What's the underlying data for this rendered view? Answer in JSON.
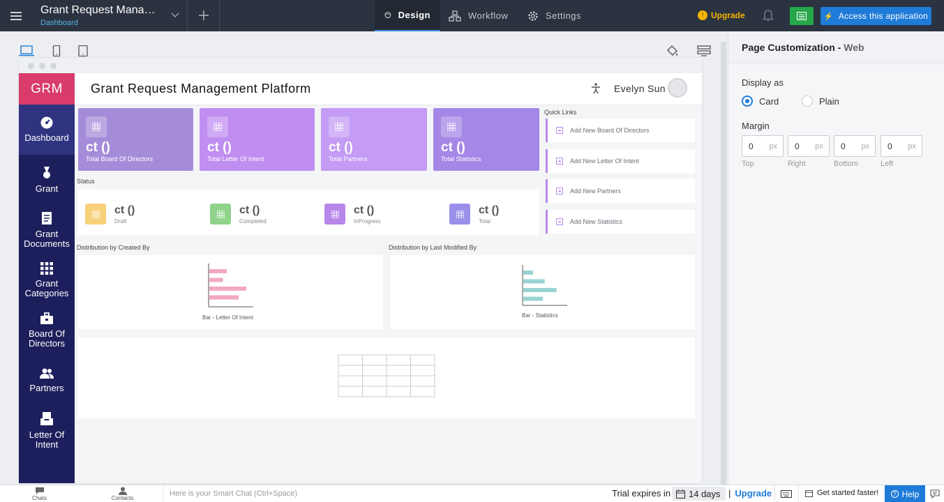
{
  "topbar": {
    "app_title": "Grant Request Manageme...",
    "app_subtitle": "Dashboard",
    "tabs": [
      {
        "label": "Design"
      },
      {
        "label": "Workflow"
      },
      {
        "label": "Settings"
      }
    ],
    "upgrade_label": "Upgrade",
    "access_label": "Access this application"
  },
  "preview": {
    "logo": "GRM",
    "sidebar": [
      {
        "label": "Dashboard"
      },
      {
        "label": "Grant"
      },
      {
        "label": "Grant Documents"
      },
      {
        "label": "Grant Categories"
      },
      {
        "label": "Board Of Directors"
      },
      {
        "label": "Partners"
      },
      {
        "label": "Letter Of Intent"
      }
    ],
    "header_title": "Grant Request Management Platform",
    "user_name": "Evelyn Sun",
    "stat_cards": [
      {
        "value": "ct ()",
        "label": "Total Board Of Directors",
        "color": "#a58cd9"
      },
      {
        "value": "ct ()",
        "label": "Total Letter Of Intent",
        "color": "#c08ef0"
      },
      {
        "value": "ct ()",
        "label": "Total Partners",
        "color": "#c49bf5"
      },
      {
        "value": "ct ()",
        "label": "Total Statistics",
        "color": "#a487e6"
      }
    ],
    "quick_links_title": "Quick Links",
    "quick_links": [
      {
        "label": "Add New Board Of Directors"
      },
      {
        "label": "Add New Letter Of Intent"
      },
      {
        "label": "Add New Partners"
      },
      {
        "label": "Add New Statistics"
      }
    ],
    "status_title": "Status",
    "status_items": [
      {
        "value": "ct ()",
        "label": "Draft",
        "color": "#f7d07a"
      },
      {
        "value": "ct ()",
        "label": "Completed",
        "color": "#8fd48a"
      },
      {
        "value": "ct ()",
        "label": "InProgress",
        "color": "#b787ea"
      },
      {
        "value": "ct ()",
        "label": "Total",
        "color": "#9a90ea"
      }
    ],
    "chart1_title": "Distribution by Created By",
    "chart2_title": "Distribution by Last Modified By"
  },
  "chart_data": [
    {
      "type": "bar",
      "orientation": "horizontal",
      "caption": "Bar - Letter Of Intent",
      "color": "#f3a9bf",
      "values": [
        0.45,
        0.35,
        0.95,
        0.75
      ]
    },
    {
      "type": "bar",
      "orientation": "horizontal",
      "caption": "Bar - Statistics",
      "color": "#9bd3d4",
      "values": [
        0.25,
        0.55,
        0.85,
        0.5
      ]
    }
  ],
  "properties": {
    "title": "Page Customization -",
    "title_suffix": "Web",
    "display_as_label": "Display as",
    "options": [
      {
        "label": "Card",
        "selected": true
      },
      {
        "label": "Plain",
        "selected": false
      }
    ],
    "margin_label": "Margin",
    "margins": [
      {
        "value": "0",
        "unit": "px",
        "caption": "Top"
      },
      {
        "value": "0",
        "unit": "px",
        "caption": "Right"
      },
      {
        "value": "0",
        "unit": "px",
        "caption": "Bottom"
      },
      {
        "value": "0",
        "unit": "px",
        "caption": "Left"
      }
    ]
  },
  "bottombar": {
    "chats": "Chats",
    "contacts": "Contacts",
    "smart_chat": "Here is your Smart Chat (Ctrl+Space)",
    "trial": "Trial expires in",
    "days": "14 days",
    "separator": "|",
    "upgrade": "Upgrade",
    "get_started": "Get started faster!",
    "help": "Help"
  }
}
